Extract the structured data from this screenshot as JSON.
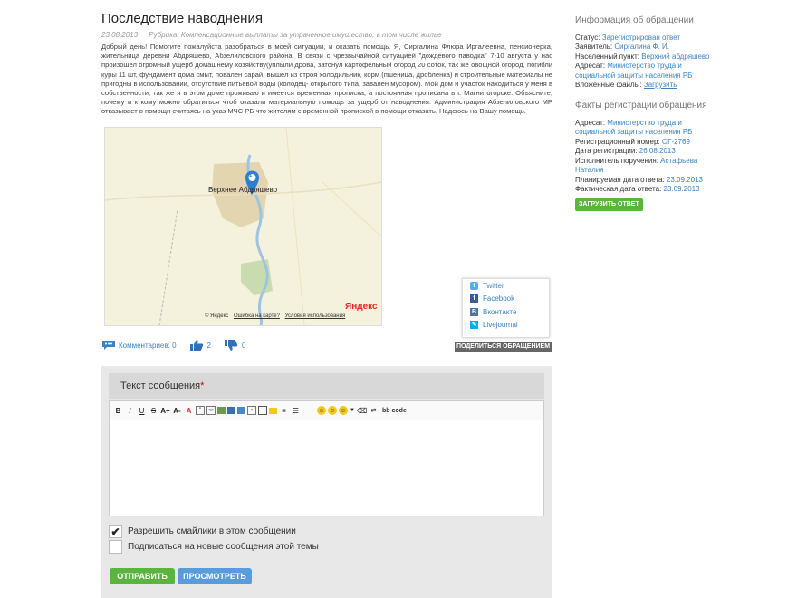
{
  "article": {
    "title": "Последствие наводнения",
    "date": "23.08.2013",
    "rubric": "Рубрика: Компенсационные выплаты за утраченное имущество, в том числе жилье",
    "body": "Добрый день! Помогите пожалуйста разобраться в моей ситуации, и оказать помощь. Я, Сиргалина Флюра Иргалеевна, пенсионерка, жительница деревни Абдряшево, Абзелиловского района. В связи с чрезвычайной ситуацией \"дождевого паводка\" 7-10 августа у нас произошел огромный ущерб домашнему хозяйству(уплыли дрова, затонул картофельный огород 20 соток, так же овощной огород, погибли куры 11 шт, фундамент дома смыт, повален сарай, вышел из строя холодильник, корм (пшеница, дробленка) и строительные материалы не пригодны в использовании, отсутствие питьевой воды (колодец- открытого типа, завален мусором). Мой дом и участок находиться у меня в собственности, так же я в этом доме проживаю и имеется временная прописка, а постоянная прописана в г. Магнитогорске. Объясните, почему и к кому можно обратиться чтоб оказали материальную помощь за ущерб от наводнения. Администрация Абзелиловского МР отказывает в помощи считаясь на указ МЧС РБ что жителям с временной пропиской в помощи отказать. Надеюсь на Вашу помощь."
  },
  "map": {
    "place_label": "Верхнее Абдряшево",
    "marker_number": "1",
    "brand": "Яндекс",
    "copyright": "© Яндекс",
    "error_link": "Ошибка на карте?",
    "terms_link": "Условия использования"
  },
  "share": {
    "items": [
      {
        "label": "Twitter",
        "color": "#55acee",
        "glyph": "t"
      },
      {
        "label": "Facebook",
        "color": "#3b5998",
        "glyph": "f"
      },
      {
        "label": "Вконтакте",
        "color": "#4c75a3",
        "glyph": "B"
      },
      {
        "label": "Livejournal",
        "color": "#00b0ea",
        "glyph": "✎"
      }
    ],
    "button": "ПОДЕЛИТЬСЯ ОБРАЩЕНИЕМ"
  },
  "stats": {
    "comments": "Комментариев: 0",
    "likes": "2",
    "dislikes": "0"
  },
  "form": {
    "header": "Текст сообщения",
    "required_mark": "*",
    "bbcode_label": "bb code",
    "allow_smiles": "Разрешить смайлики в этом сообщении",
    "allow_smiles_checked": true,
    "subscribe": "Подписаться на новые сообщения этой темы",
    "subscribe_checked": false,
    "submit": "ОТПРАВИТЬ",
    "preview": "ПРОСМОТРЕТЬ"
  },
  "info": {
    "title": "Информация об обращении",
    "status_label": "Статус:",
    "status_value": "Зарегистрирован ответ",
    "applicant_label": "Заявитель:",
    "applicant_value": "Сиргалина Ф. И.",
    "locality_label": "Населенный пункт:",
    "locality_value": "Верхний абдряшево",
    "addressee_label": "Адресат:",
    "addressee_value": "Министерство труда и социальной защиты населения РБ",
    "files_label": "Вложенные файлы:",
    "files_value": "Загрузить"
  },
  "facts": {
    "title": "Факты регистрации обращения",
    "addressee_label": "Адресат:",
    "addressee_value": "Министерство труда и социальной защиты населения РБ",
    "reg_num_label": "Регистрационный номер:",
    "reg_num_value": "ОГ-2769",
    "reg_date_label": "Дата регистрации:",
    "reg_date_value": "26.08.2013",
    "executor_label": "Исполнитель поручения:",
    "executor_value": "Астафьева Наталия",
    "planned_label": "Планируемая дата ответа:",
    "planned_value": "23.09.2013",
    "actual_label": "Фактическая дата ответа:",
    "actual_value": "23.09.2013",
    "upload_button": "ЗАГРУЗИТЬ ОТВЕТ"
  }
}
